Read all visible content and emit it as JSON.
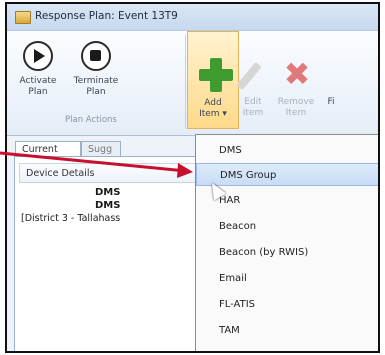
{
  "window": {
    "title": "Response Plan: Event 13T9"
  },
  "ribbon": {
    "activate_label": "Activate\nPlan",
    "terminate_label": "Terminate\nPlan",
    "group_label": "Plan Actions",
    "add_label": "Add\nItem ▾",
    "edit_label": "Edit\nItem",
    "remove_label": "Remove\nItem",
    "overflow_label": "Fi"
  },
  "tabs": [
    {
      "label": "Current Plan"
    },
    {
      "label": "Sugg"
    }
  ],
  "panel": {
    "header": "Device Details",
    "line1": "DMS",
    "line2": "DMS",
    "line3": "[District 3 - Tallahass"
  },
  "menu": {
    "items": [
      {
        "label": "DMS"
      },
      {
        "label": "DMS Group",
        "highlighted": true
      },
      {
        "label": "HAR"
      },
      {
        "label": "Beacon"
      },
      {
        "label": "Beacon (by RWIS)"
      },
      {
        "label": "Email"
      },
      {
        "label": "FL-ATIS"
      },
      {
        "label": "TAM"
      }
    ]
  },
  "colors": {
    "annotation_arrow": "#c8102e",
    "add_icon": "#3f9a2f",
    "remove_icon": "#e07a7a"
  }
}
